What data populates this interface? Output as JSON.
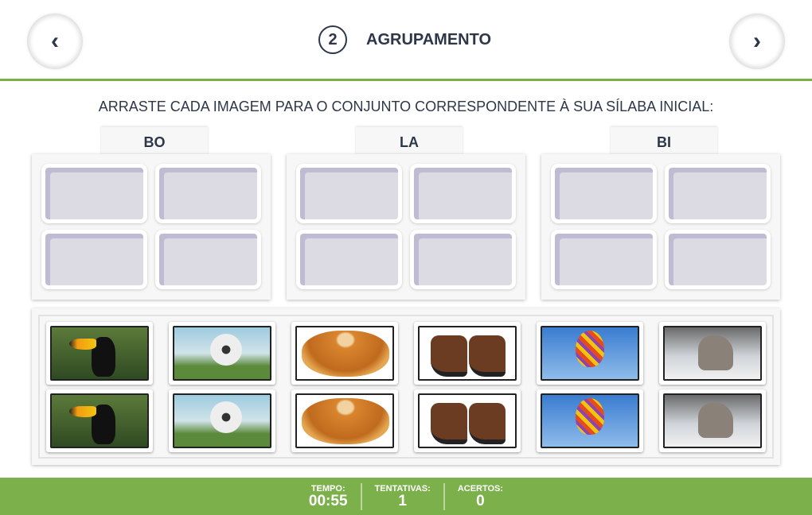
{
  "header": {
    "step_number": "2",
    "title": "AGRUPAMENTO",
    "prev_icon": "chevron-left-icon",
    "next_icon": "chevron-right-icon",
    "prev_glyph": "‹",
    "next_glyph": "›"
  },
  "instruction": "ARRASTE CADA IMAGEM PARA O CONJUNTO CORRESPONDENTE À SUA SÍLABA INICIAL:",
  "groups": [
    {
      "label": "BO"
    },
    {
      "label": "LA"
    },
    {
      "label": "BI"
    }
  ],
  "cards": [
    "toucan",
    "soccer-ball",
    "cake",
    "boots",
    "hot-air-balloon",
    "wolf",
    "toucan",
    "soccer-ball",
    "cake",
    "boots",
    "hot-air-balloon",
    "wolf"
  ],
  "footer": {
    "time_label": "TEMPO:",
    "time_value": "00:55",
    "attempts_label": "TENTATIVAS:",
    "attempts_value": "1",
    "hits_label": "ACERTOS:",
    "hits_value": "0"
  },
  "colors": {
    "accent": "#7cb04b",
    "text": "#2d3748",
    "slot": "#dcdae3"
  }
}
